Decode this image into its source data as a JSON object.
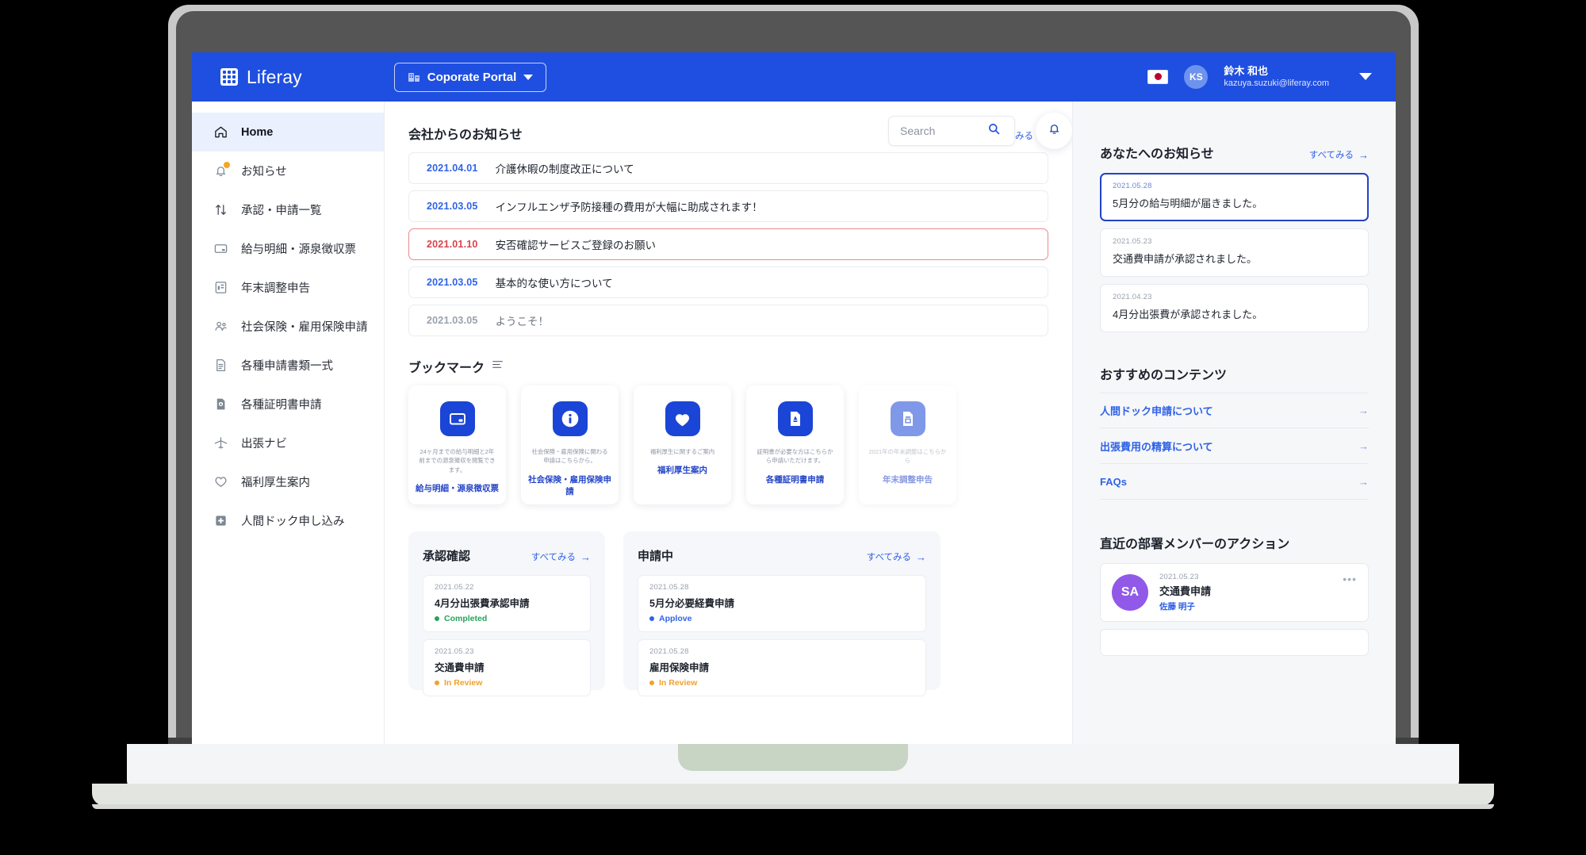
{
  "topbar": {
    "brand": "Liferay",
    "portal_button": "Coporate Portal",
    "portal_icon": "building-icon",
    "flag_icon": "japan-flag-icon",
    "avatar_initials": "KS",
    "user_name": "鈴木 和也",
    "user_email": "kazuya.suzuki@liferay.com",
    "chevron_icon": "chevron-down-icon"
  },
  "sidebar": {
    "items": [
      {
        "label": "Home",
        "icon": "home-icon",
        "active": true,
        "badge": false
      },
      {
        "label": "お知らせ",
        "icon": "bell-icon",
        "active": false,
        "badge": true
      },
      {
        "label": "承認・申請一覧",
        "icon": "arrows-updown-icon",
        "active": false,
        "badge": false
      },
      {
        "label": "給与明細・源泉徴収票",
        "icon": "card-icon",
        "active": false,
        "badge": false
      },
      {
        "label": "年末調整申告",
        "icon": "report-icon",
        "active": false,
        "badge": false
      },
      {
        "label": "社会保険・雇用保険申請",
        "icon": "people-icon",
        "active": false,
        "badge": false
      },
      {
        "label": "各種申請書類一式",
        "icon": "document-icon",
        "active": false,
        "badge": false
      },
      {
        "label": "各種証明書申請",
        "icon": "certificate-icon",
        "active": false,
        "badge": false
      },
      {
        "label": "出張ナビ",
        "icon": "airplane-icon",
        "active": false,
        "badge": false
      },
      {
        "label": "福利厚生案内",
        "icon": "heart-icon",
        "active": false,
        "badge": false
      },
      {
        "label": "人間ドック申し込み",
        "icon": "medical-cross-icon",
        "active": false,
        "badge": false
      }
    ]
  },
  "search": {
    "placeholder": "Search",
    "value": "",
    "icon": "search-icon"
  },
  "notifications_button": {
    "icon": "bell-icon"
  },
  "announcements": {
    "title": "会社からのお知らせ",
    "view_all": "すべてみる",
    "view_all_arrow": "→",
    "rows": [
      {
        "date": "2021.04.01",
        "text": "介護休暇の制度改正について",
        "style": "normal"
      },
      {
        "date": "2021.03.05",
        "text": "インフルエンザ予防接種の費用が大幅に助成されます！",
        "style": "normal"
      },
      {
        "date": "2021.01.10",
        "text": "安否確認サービスご登録のお願い",
        "style": "alert"
      },
      {
        "date": "2021.03.05",
        "text": "基本的な使い方について",
        "style": "normal"
      },
      {
        "date": "2021.03.05",
        "text": "ようこそ！",
        "style": "muted"
      }
    ]
  },
  "bookmarks": {
    "title": "ブックマーク",
    "settings_icon": "list-settings-icon",
    "cards": [
      {
        "icon": "payslip-card-icon",
        "desc": "24ヶ月までの給与明細と2年前までの源泉徴収を閲覧できます。",
        "label": "給与明細・源泉徴収票",
        "faded": false
      },
      {
        "icon": "info-icon",
        "desc": "社会保険・雇用保険に関わる申請はこちらから。",
        "label": "社会保険・雇用保険申請",
        "faded": false
      },
      {
        "icon": "heart-icon",
        "desc": "福利厚生に関するご案内",
        "label": "福利厚生案内",
        "faded": false
      },
      {
        "icon": "certificate-doc-icon",
        "desc": "証明書が必要な方はこちらから申請いただけます。",
        "label": "各種証明書申請",
        "faded": false
      },
      {
        "icon": "report-doc-icon",
        "desc": "2021年の年末調整はこちらから",
        "label": "年末調整申告",
        "faded": true
      }
    ]
  },
  "approval_panel": {
    "title": "承認確認",
    "view_all": "すべてみる",
    "view_all_arrow": "→",
    "items": [
      {
        "date": "2021.05.22",
        "name": "4月分出張費承認申請",
        "status": "Completed",
        "status_color": "#27a35b"
      },
      {
        "date": "2021.05.23",
        "name": "交通費申請",
        "status": "In Review",
        "status_color": "#f0a22e"
      }
    ]
  },
  "applying_panel": {
    "title": "申請中",
    "view_all": "すべてみる",
    "view_all_arrow": "→",
    "items": [
      {
        "date": "2021.05.28",
        "name": "5月分必要経費申請",
        "status": "Applove",
        "status_color": "#2f62e8"
      },
      {
        "date": "2021.05.28",
        "name": "雇用保険申請",
        "status": "In Review",
        "status_color": "#f0a22e"
      }
    ]
  },
  "right_panel": {
    "notices": {
      "title": "あなたへのお知らせ",
      "view_all": "すべてみる",
      "view_all_arrow": "→",
      "items": [
        {
          "date": "2021.05.28",
          "message": "5月分の給与明細が届きました。",
          "selected": true
        },
        {
          "date": "2021.05.23",
          "message": "交通費申請が承認されました。",
          "selected": false
        },
        {
          "date": "2021.04.23",
          "message": "4月分出張費が承認されました。",
          "selected": false
        }
      ]
    },
    "recommended": {
      "title": "おすすめのコンテンツ",
      "arrow": "→",
      "items": [
        {
          "label": "人間ドック申請について"
        },
        {
          "label": "出張費用の精算について"
        },
        {
          "label": "FAQs"
        }
      ]
    },
    "actions": {
      "title": "直近の部署メンバーのアクション",
      "more_icon": "more-horizontal-icon",
      "items": [
        {
          "initials": "SA",
          "date": "2021.05.23",
          "name": "交通費申請",
          "person": "佐藤 明子",
          "avatar_color": "#9159e8"
        }
      ]
    }
  },
  "colors": {
    "brand_blue": "#1f4fe0",
    "accent_blue": "#2f62e8",
    "alert_red": "#d9434a",
    "success_green": "#27a35b",
    "warning_orange": "#f0a22e",
    "avatar_purple": "#9159e8"
  }
}
